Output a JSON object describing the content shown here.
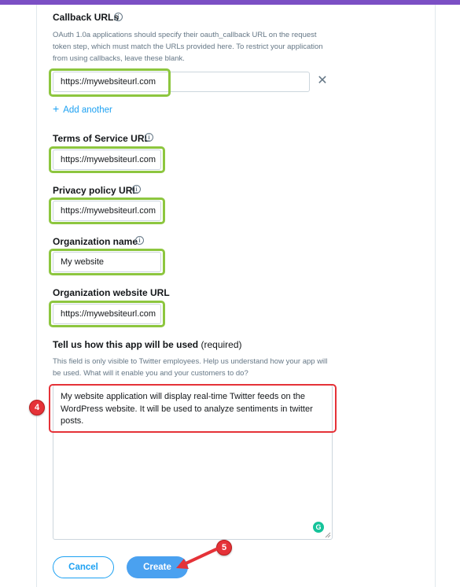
{
  "callback": {
    "label": "Callback URLs",
    "help": "OAuth 1.0a applications should specify their oauth_callback URL on the request token step, which must match the URLs provided here. To restrict your application from using callbacks, leave these blank.",
    "value": "https://mywebsiteurl.com",
    "add_another": "Add another"
  },
  "terms": {
    "label": "Terms of Service URL",
    "value": "https://mywebsiteurl.com"
  },
  "privacy": {
    "label": "Privacy policy URL",
    "value": "https://mywebsiteurl.com"
  },
  "org_name": {
    "label": "Organization name",
    "value": "My website"
  },
  "org_url": {
    "label": "Organization website URL",
    "value": "https://mywebsiteurl.com"
  },
  "usage": {
    "label": "Tell us how this app will be used",
    "required": "(required)",
    "help": "This field is only visible to Twitter employees. Help us understand how your app will be used. What will it enable you and your customers to do?",
    "value": "My website application will display real-time Twitter feeds on the WordPress website. It will be used to analyze sentiments in twitter posts."
  },
  "annotations": {
    "step4": "4",
    "step5": "5"
  },
  "buttons": {
    "cancel": "Cancel",
    "create": "Create"
  },
  "grammarly_glyph": "G",
  "colors": {
    "accent": "#1da1f2",
    "highlight_green": "#8dc63f",
    "highlight_red": "#e53238",
    "top_bar": "#7b4fc4"
  }
}
